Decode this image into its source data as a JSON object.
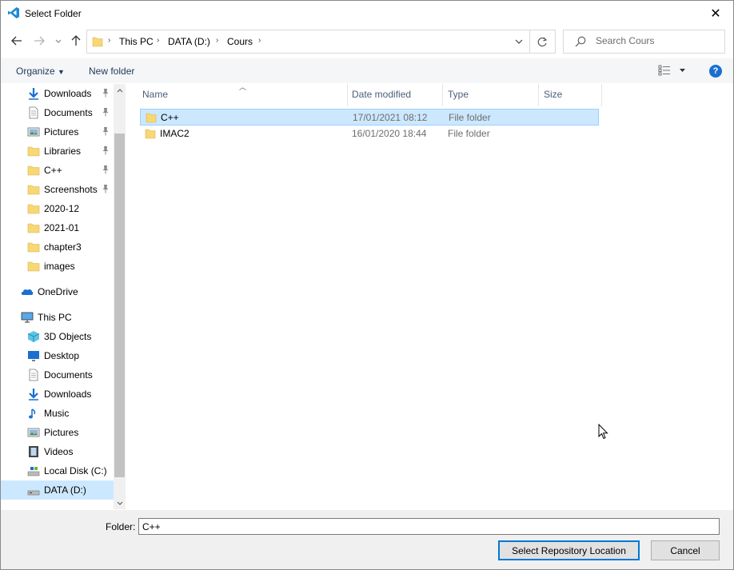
{
  "window": {
    "title": "Select Folder",
    "close_glyph": "✕"
  },
  "navigation": {
    "breadcrumbs": [
      "This PC",
      "DATA (D:)",
      "Cours"
    ],
    "search_placeholder": "Search Cours"
  },
  "commands": {
    "organize": "Organize",
    "new_folder": "New folder"
  },
  "sidebar": {
    "quick_access": [
      {
        "label": "Downloads",
        "icon": "downloads-icon",
        "pinned": true
      },
      {
        "label": "Documents",
        "icon": "documents-icon",
        "pinned": true
      },
      {
        "label": "Pictures",
        "icon": "pictures-icon",
        "pinned": true
      },
      {
        "label": "Libraries",
        "icon": "folder-icon",
        "pinned": true
      },
      {
        "label": "C++",
        "icon": "folder-icon",
        "pinned": true
      },
      {
        "label": "Screenshots",
        "icon": "folder-icon",
        "pinned": true
      },
      {
        "label": "2020-12",
        "icon": "folder-icon",
        "pinned": false
      },
      {
        "label": "2021-01",
        "icon": "folder-icon",
        "pinned": false
      },
      {
        "label": "chapter3",
        "icon": "folder-icon",
        "pinned": false
      },
      {
        "label": "images",
        "icon": "folder-icon",
        "pinned": false
      }
    ],
    "onedrive": "OneDrive",
    "this_pc": "This PC",
    "this_pc_items": [
      {
        "label": "3D Objects",
        "icon": "3d-objects-icon"
      },
      {
        "label": "Desktop",
        "icon": "desktop-icon"
      },
      {
        "label": "Documents",
        "icon": "documents-icon"
      },
      {
        "label": "Downloads",
        "icon": "downloads-icon"
      },
      {
        "label": "Music",
        "icon": "music-icon"
      },
      {
        "label": "Pictures",
        "icon": "pictures-icon"
      },
      {
        "label": "Videos",
        "icon": "videos-icon"
      },
      {
        "label": "Local Disk (C:)",
        "icon": "local-disk-icon"
      },
      {
        "label": "DATA (D:)",
        "icon": "drive-icon",
        "selected": true
      }
    ]
  },
  "columns": {
    "name": "Name",
    "date": "Date modified",
    "type": "Type",
    "size": "Size"
  },
  "files": [
    {
      "name": "C++",
      "date": "17/01/2021 08:12",
      "type": "File folder",
      "selected": true
    },
    {
      "name": "IMAC2",
      "date": "16/01/2020 18:44",
      "type": "File folder",
      "selected": false
    }
  ],
  "footer": {
    "folder_label": "Folder:",
    "folder_value": "C++",
    "select_button": "Select Repository Location",
    "cancel_button": "Cancel"
  },
  "colors": {
    "accent": "#0078d7",
    "selection": "#cce8ff",
    "folder": "#f8d775"
  }
}
